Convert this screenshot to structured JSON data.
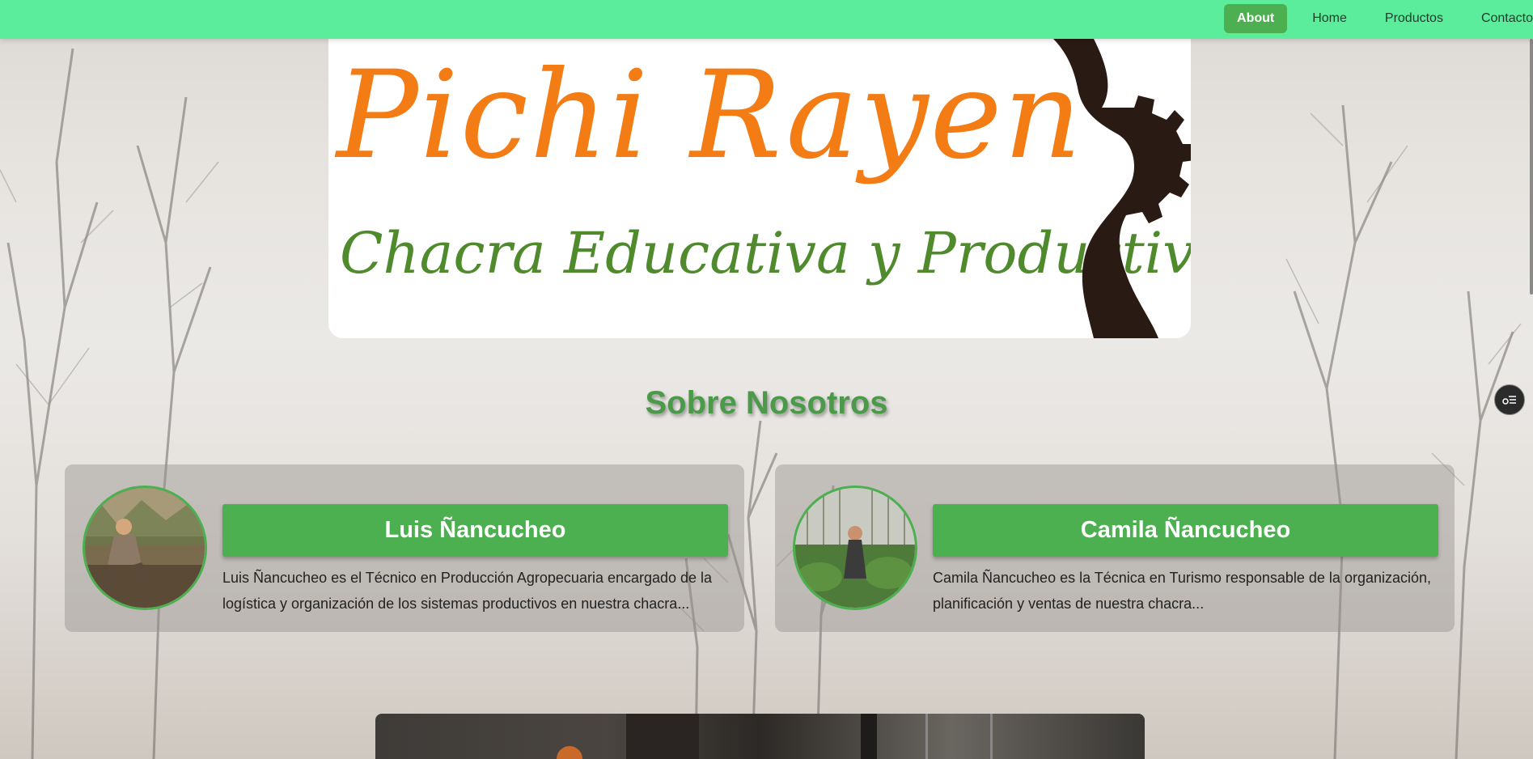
{
  "nav": {
    "items": [
      {
        "label": "About",
        "active": true
      },
      {
        "label": "Home",
        "active": false
      },
      {
        "label": "Productos",
        "active": false
      },
      {
        "label": "Contacto",
        "active": false
      }
    ]
  },
  "logo": {
    "title": "Pichi Rayen",
    "subtitle": "Chacra Educativa y Productiva",
    "colors": {
      "title": "#f37c15",
      "subtitle": "#4f8a2c",
      "gear": "#2a1a14"
    }
  },
  "about": {
    "title": "Sobre Nosotros",
    "members": [
      {
        "name": "Luis Ñancucheo",
        "description": "Luis Ñancucheo es el Técnico en Producción Agropecuaria encargado de la logística y organización de los sistemas productivos en nuestra chacra...",
        "avatar": "man-in-field-photo"
      },
      {
        "name": "Camila Ñancucheo",
        "description": "Camila Ñancucheo es la Técnica en Turismo responsable de la organización, planificación y ventas de nuestra chacra...",
        "avatar": "woman-in-garden-photo"
      }
    ]
  },
  "floating_button": {
    "icon": "settings-list-icon"
  },
  "colors": {
    "navbar": "#5ced9c",
    "accent": "#4caf50",
    "section_title": "#4a9a4a"
  }
}
